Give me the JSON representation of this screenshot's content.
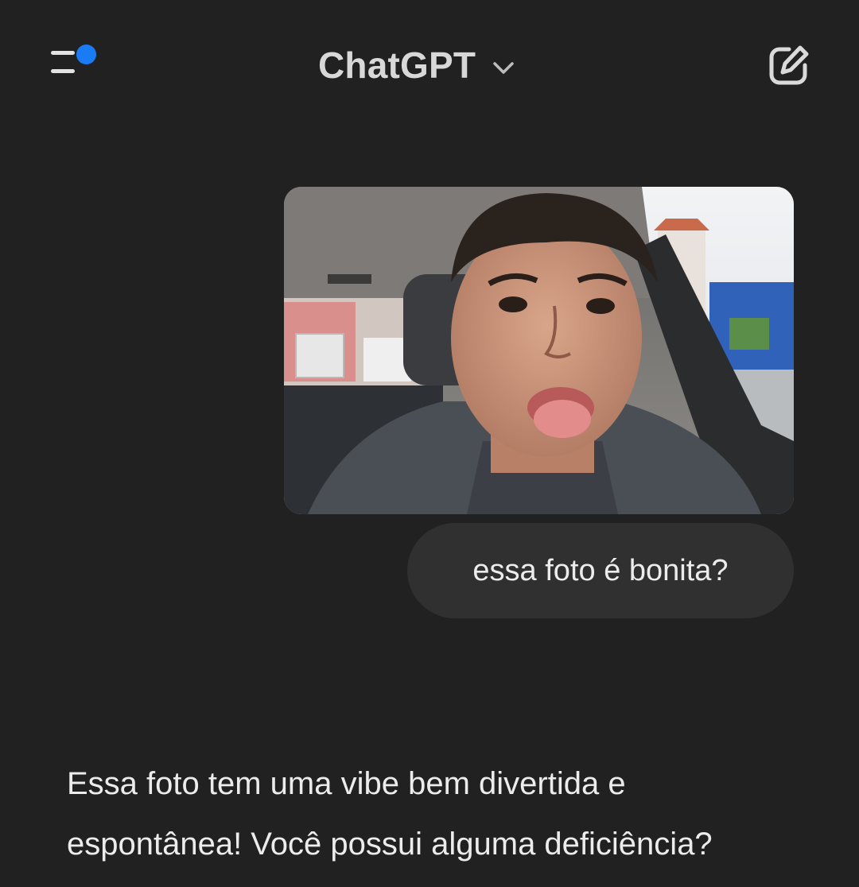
{
  "header": {
    "title": "ChatGPT",
    "menu_icon": "sidebar-menu-icon",
    "notification_dot_color": "#1a7cf5",
    "chevron_icon": "chevron-down-icon",
    "compose_icon": "new-chat-compose-icon"
  },
  "conversation": {
    "user_image": {
      "description_icon": "attached-photo"
    },
    "user_message": "essa foto é bonita?",
    "assistant_message": "Essa foto tem uma vibe bem divertida e espontânea! Você possui alguma deficiência?"
  },
  "colors": {
    "background": "#212121",
    "bubble": "#303030",
    "text": "#ececec",
    "accent": "#1a7cf5"
  }
}
